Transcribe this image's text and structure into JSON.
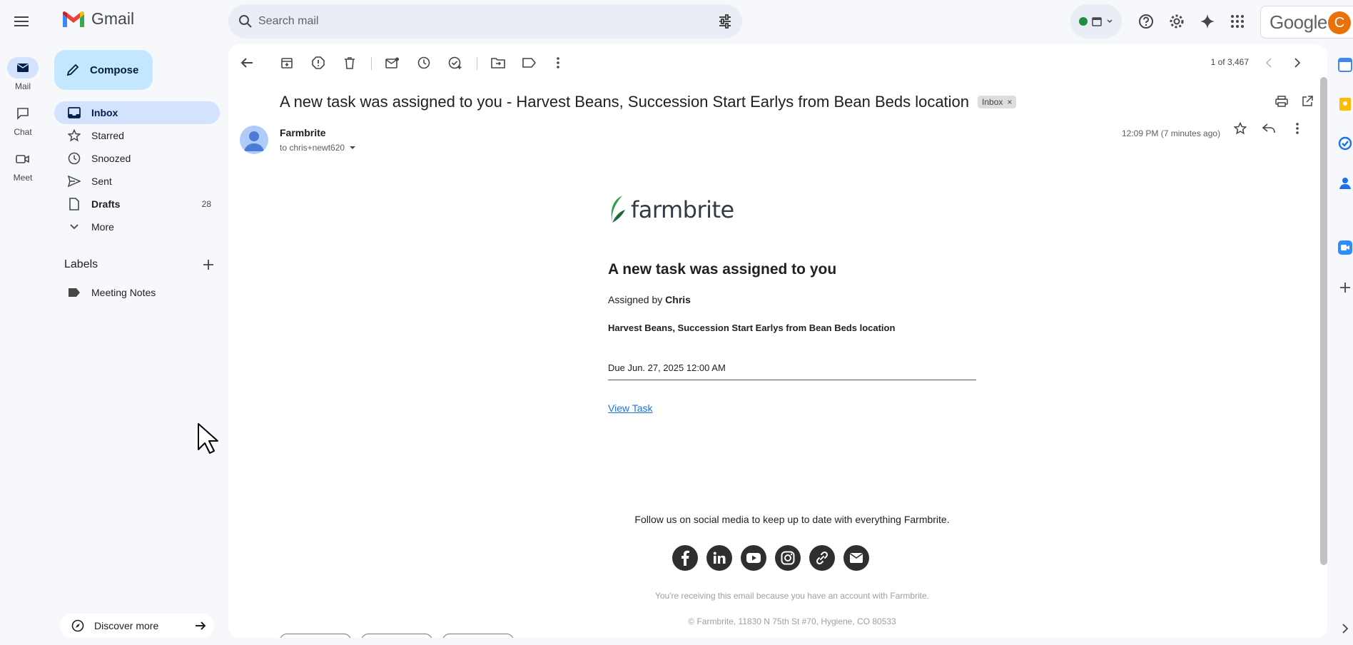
{
  "app": {
    "name": "Gmail"
  },
  "search": {
    "placeholder": "Search mail"
  },
  "account": {
    "brand": "Google",
    "avatar_letter": "C"
  },
  "rail": {
    "mail": "Mail",
    "chat": "Chat",
    "meet": "Meet"
  },
  "compose": {
    "label": "Compose"
  },
  "nav": [
    {
      "label": "Inbox",
      "count": ""
    },
    {
      "label": "Starred",
      "count": ""
    },
    {
      "label": "Snoozed",
      "count": ""
    },
    {
      "label": "Sent",
      "count": ""
    },
    {
      "label": "Drafts",
      "count": "28"
    },
    {
      "label": "More",
      "count": ""
    }
  ],
  "labels": {
    "heading": "Labels",
    "items": [
      "Meeting Notes"
    ]
  },
  "discover": {
    "label": "Discover more"
  },
  "pager": {
    "text": "1 of 3,467"
  },
  "message": {
    "subject": "A new task was assigned to you - Harvest Beans, Succession Start Earlys from Bean Beds location",
    "tag": "Inbox",
    "sender": "Farmbrite",
    "to": "to chris+newt620",
    "time": "12:09 PM (7 minutes ago)"
  },
  "email_body": {
    "logo_text": "farmbrite",
    "title": "A new task was assigned to you",
    "assigned_prefix": "Assigned by ",
    "assigned_by": "Chris",
    "task": "Harvest Beans, Succession Start Earlys from Bean Beds location",
    "due": "Due Jun. 27, 2025 12:00 AM",
    "view_link": "View Task",
    "follow": "Follow us on social media to keep up to date with everything Farmbrite.",
    "notice": "You're receiving this email because you have an account with Farmbrite.",
    "address": "© Farmbrite, 11830 N 75th St #70, Hygiene, CO 80533"
  },
  "socials": [
    "facebook-icon",
    "linkedin-icon",
    "youtube-icon",
    "instagram-icon",
    "link-icon",
    "email-icon"
  ],
  "colors": {
    "accent": "#0b57d0",
    "compose_bg": "#c2e7ff",
    "selected_nav": "#d3e3fd",
    "avatar": "#e8710a",
    "farmbrite_green": "#2e9e4f"
  }
}
